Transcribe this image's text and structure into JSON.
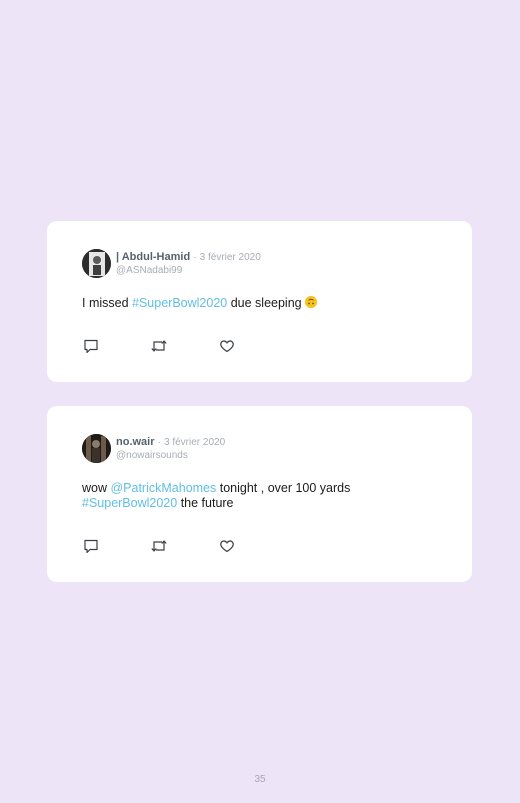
{
  "tweets": [
    {
      "name": "| Abdul-Hamid",
      "separator": "·",
      "date": "3 février 2020",
      "handle": "@ASNadabi99",
      "text_before": "I missed ",
      "hashtag": "#SuperBowl2020",
      "text_after": " due sleeping ",
      "emoji": "upside-down-face-emoji",
      "actions": [
        "reply-icon",
        "retweet-icon",
        "like-icon"
      ]
    },
    {
      "name": "no.wair",
      "separator": "·",
      "date": "3 février 2020",
      "handle": "@nowairsounds",
      "text_before": "wow ",
      "mention": "@PatrickMahomes",
      "text_middle": " tonight , over 100 yards",
      "hashtag": "#SuperBowl2020",
      "text_after": " the future",
      "actions": [
        "reply-icon",
        "retweet-icon",
        "like-icon"
      ]
    }
  ],
  "page_number": "35",
  "colors": {
    "background": "#eee4f8",
    "card": "#ffffff",
    "link": "#5fbfe4",
    "muted": "#a7adb5",
    "name": "#56626e"
  }
}
